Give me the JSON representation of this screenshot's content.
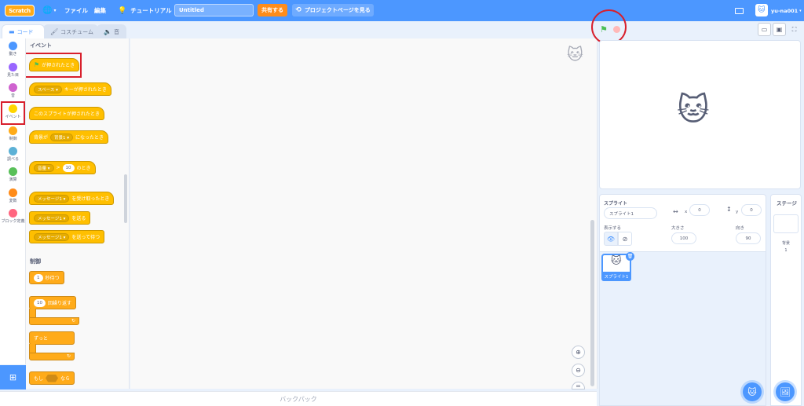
{
  "menubar": {
    "logo": "Scratch",
    "file": "ファイル",
    "edit": "編集",
    "tutorial": "チュートリアル",
    "project_title": "Untitled",
    "share": "共有する",
    "project_page": "プロジェクトページを見る",
    "username": "yu-na001"
  },
  "tabs": {
    "code": "コード",
    "costume": "コスチューム",
    "sound": "音"
  },
  "categories": [
    {
      "label": "動き",
      "color": "#4c97ff"
    },
    {
      "label": "見た目",
      "color": "#9966ff"
    },
    {
      "label": "音",
      "color": "#cf63cf"
    },
    {
      "label": "イベント",
      "color": "#ffd500"
    },
    {
      "label": "制御",
      "color": "#ffab19"
    },
    {
      "label": "調べる",
      "color": "#5cb1d6"
    },
    {
      "label": "演算",
      "color": "#59c059"
    },
    {
      "label": "変数",
      "color": "#ff8c1a"
    },
    {
      "label": "ブロック定義",
      "color": "#ff6680"
    }
  ],
  "palette": {
    "events_heading": "イベント",
    "when_flag_clicked": "が押されたとき",
    "key_dd": "スペース ▾",
    "when_key_pressed": "キーが押されたとき",
    "when_sprite_clicked": "このスプライトが押されたとき",
    "backdrop_prefix": "背景が",
    "backdrop_dd": "背景1 ▾",
    "backdrop_suffix": "になったとき",
    "loudness_dd": "音量 ▾",
    "loudness_gt": ">",
    "loudness_val": "10",
    "loudness_suffix": "のとき",
    "msg_dd": "メッセージ1 ▾",
    "when_receive": "を受け取ったとき",
    "broadcast": "を送る",
    "broadcast_wait": "を送って待つ",
    "control_heading": "制御",
    "wait_val": "1",
    "wait_label": "秒待つ",
    "repeat_val": "10",
    "repeat_label": "回繰り返す",
    "forever": "ずっと",
    "if_label": "もし",
    "then_label": "なら"
  },
  "backpack": "バックパック",
  "sprite_info": {
    "sprite_label": "スプライト",
    "sprite_name": "スプライト1",
    "x_label": "x",
    "x_value": "0",
    "y_label": "y",
    "y_value": "0",
    "show_label": "表示する",
    "size_label": "大きさ",
    "size_value": "100",
    "direction_label": "向き",
    "direction_value": "90"
  },
  "sprite_list": [
    {
      "name": "スプライト1"
    }
  ],
  "stage_column": {
    "title": "ステージ",
    "backdrops_label": "背景",
    "backdrop_count": "1"
  }
}
